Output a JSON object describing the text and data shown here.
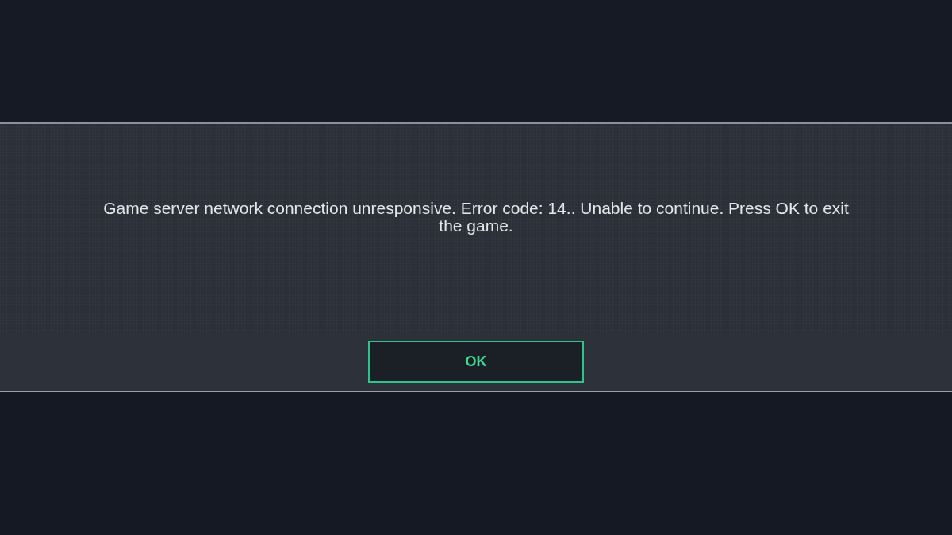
{
  "dialog": {
    "message": "Game server network connection unresponsive. Error code: 14.. Unable to continue. Press OK to exit the game.",
    "buttons": [
      {
        "label": "OK",
        "selected": true
      }
    ]
  }
}
